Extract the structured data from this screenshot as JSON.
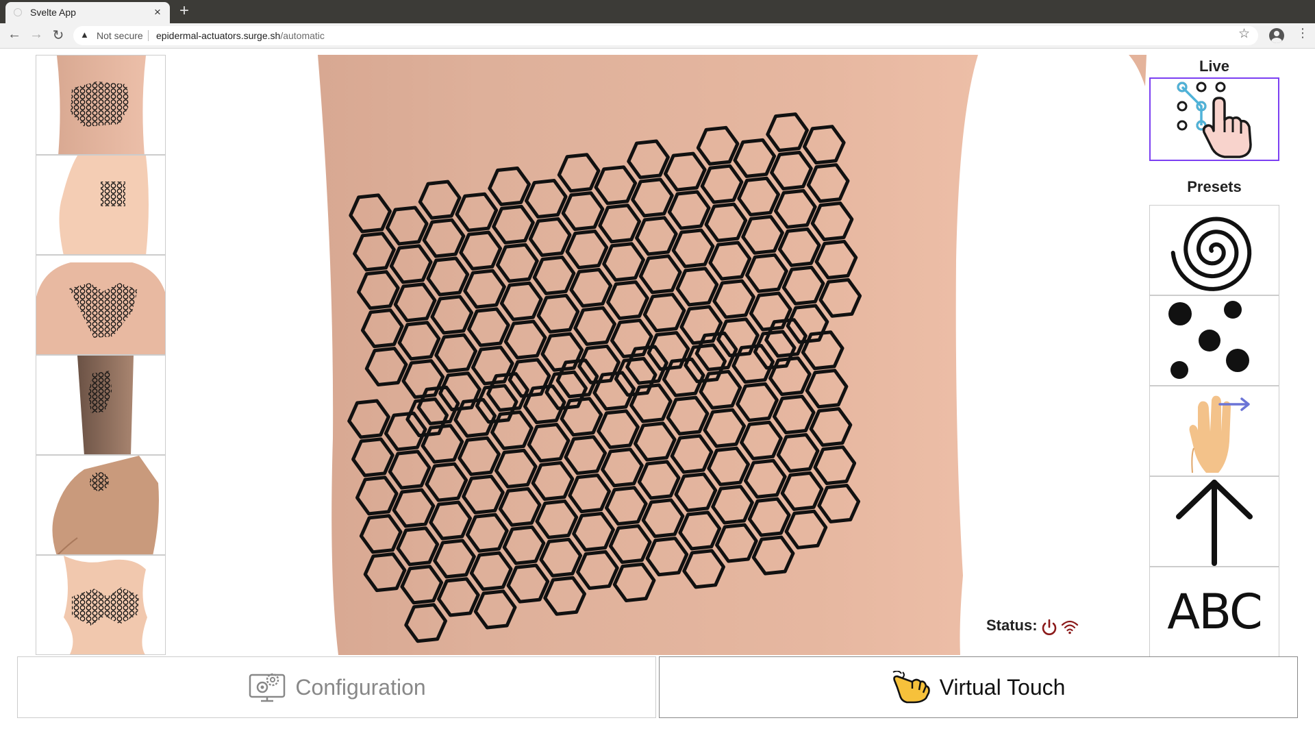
{
  "browser": {
    "tab_title": "Svelte App",
    "tab_close": "×",
    "new_tab": "+",
    "back": "←",
    "forward": "→",
    "reload": "↻",
    "security_label": "Not secure",
    "url_host": "epidermal-actuators.surge.sh",
    "url_path": "/automatic",
    "bookmark_star": "☆",
    "menu": "⋮"
  },
  "body_locations": [
    {
      "name": "lower back"
    },
    {
      "name": "upper arm"
    },
    {
      "name": "upper back"
    },
    {
      "name": "forearm"
    },
    {
      "name": "hand"
    },
    {
      "name": "abdomen"
    }
  ],
  "status": {
    "label": "Status:",
    "icon_color": "#8b1a1a"
  },
  "right_panel": {
    "live_title": "Live",
    "presets_title": "Presets",
    "presets": [
      {
        "icon": "spiral-icon"
      },
      {
        "icon": "dots-icon"
      },
      {
        "icon": "swipe-hand-icon"
      },
      {
        "icon": "arrow-up-icon"
      },
      {
        "icon": "abc-text-icon",
        "label": "ABC"
      }
    ],
    "live_accent": "#7b3ff2"
  },
  "bottom_bar": {
    "configuration_label": "Configuration",
    "virtual_touch_label": "Virtual Touch"
  },
  "colors": {
    "skin_light": "#e6b9a2",
    "skin_dark": "#d4a58e",
    "hex_stroke": "#111111"
  }
}
